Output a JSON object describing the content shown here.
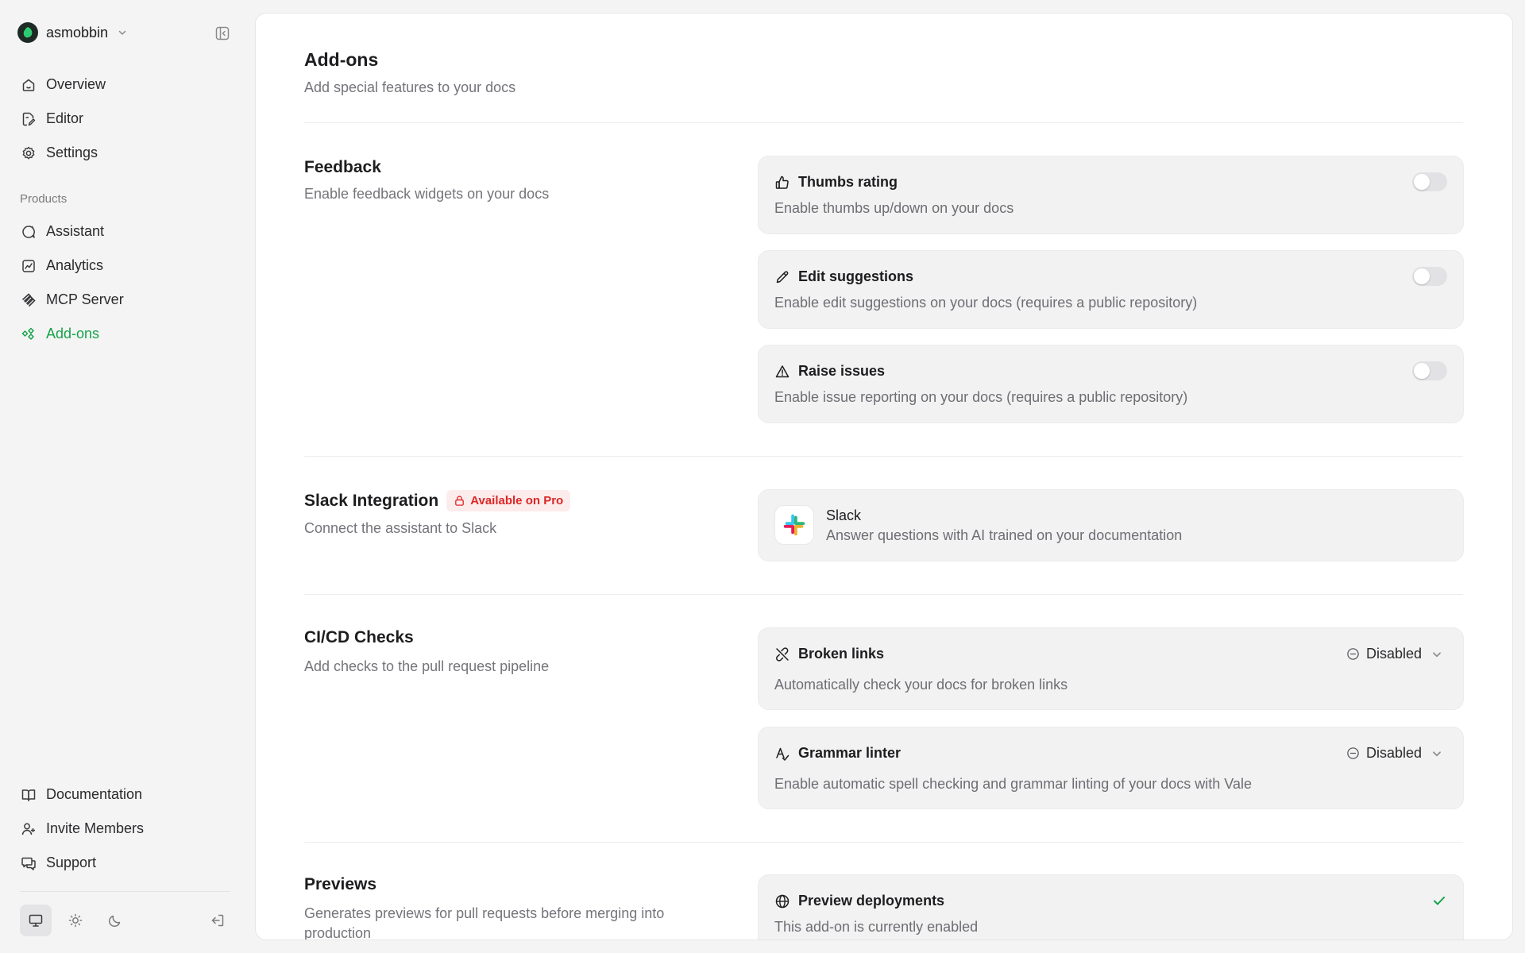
{
  "org": {
    "name": "asmobbin"
  },
  "nav": {
    "primary": [
      {
        "label": "Overview",
        "icon": "home-icon"
      },
      {
        "label": "Editor",
        "icon": "file-edit-icon"
      },
      {
        "label": "Settings",
        "icon": "gear-icon"
      }
    ],
    "products_label": "Products",
    "products": [
      {
        "label": "Assistant",
        "icon": "chat-sparkle-icon"
      },
      {
        "label": "Analytics",
        "icon": "chart-line-icon"
      },
      {
        "label": "MCP Server",
        "icon": "mcp-icon"
      },
      {
        "label": "Add-ons",
        "icon": "addons-icon",
        "active": true
      }
    ],
    "footer": [
      {
        "label": "Documentation",
        "icon": "book-icon"
      },
      {
        "label": "Invite Members",
        "icon": "user-plus-icon"
      },
      {
        "label": "Support",
        "icon": "support-icon"
      }
    ],
    "theme_modes": [
      "system",
      "light",
      "dark"
    ],
    "active_theme": "system"
  },
  "page": {
    "title": "Add-ons",
    "subtitle": "Add special features to your docs"
  },
  "sections": {
    "feedback": {
      "title": "Feedback",
      "description": "Enable feedback widgets on your docs",
      "cards": [
        {
          "title": "Thumbs rating",
          "description": "Enable thumbs up/down on your docs",
          "enabled": false
        },
        {
          "title": "Edit suggestions",
          "description": "Enable edit suggestions on your docs (requires a public repository)",
          "enabled": false
        },
        {
          "title": "Raise issues",
          "description": "Enable issue reporting on your docs (requires a public repository)",
          "enabled": false
        }
      ]
    },
    "slack": {
      "title": "Slack Integration",
      "badge": "Available on Pro",
      "description": "Connect the assistant to Slack",
      "card": {
        "name": "Slack",
        "description": "Answer questions with AI trained on your documentation"
      }
    },
    "cicd": {
      "title": "CI/CD Checks",
      "description": "Add checks to the pull request pipeline",
      "cards": [
        {
          "title": "Broken links",
          "description": "Automatically check your docs for broken links",
          "status": "Disabled"
        },
        {
          "title": "Grammar linter",
          "description": "Enable automatic spell checking and grammar linting of your docs with Vale",
          "status": "Disabled"
        }
      ]
    },
    "previews": {
      "title": "Previews",
      "description": "Generates previews for pull requests before merging into production",
      "card": {
        "title": "Preview deployments",
        "description": "This add-on is currently enabled"
      }
    }
  },
  "colors": {
    "accent": "#16a34a",
    "pro_badge_text": "#dc2626",
    "pro_badge_bg": "#fdecec",
    "card_bg": "#f2f2f3"
  }
}
